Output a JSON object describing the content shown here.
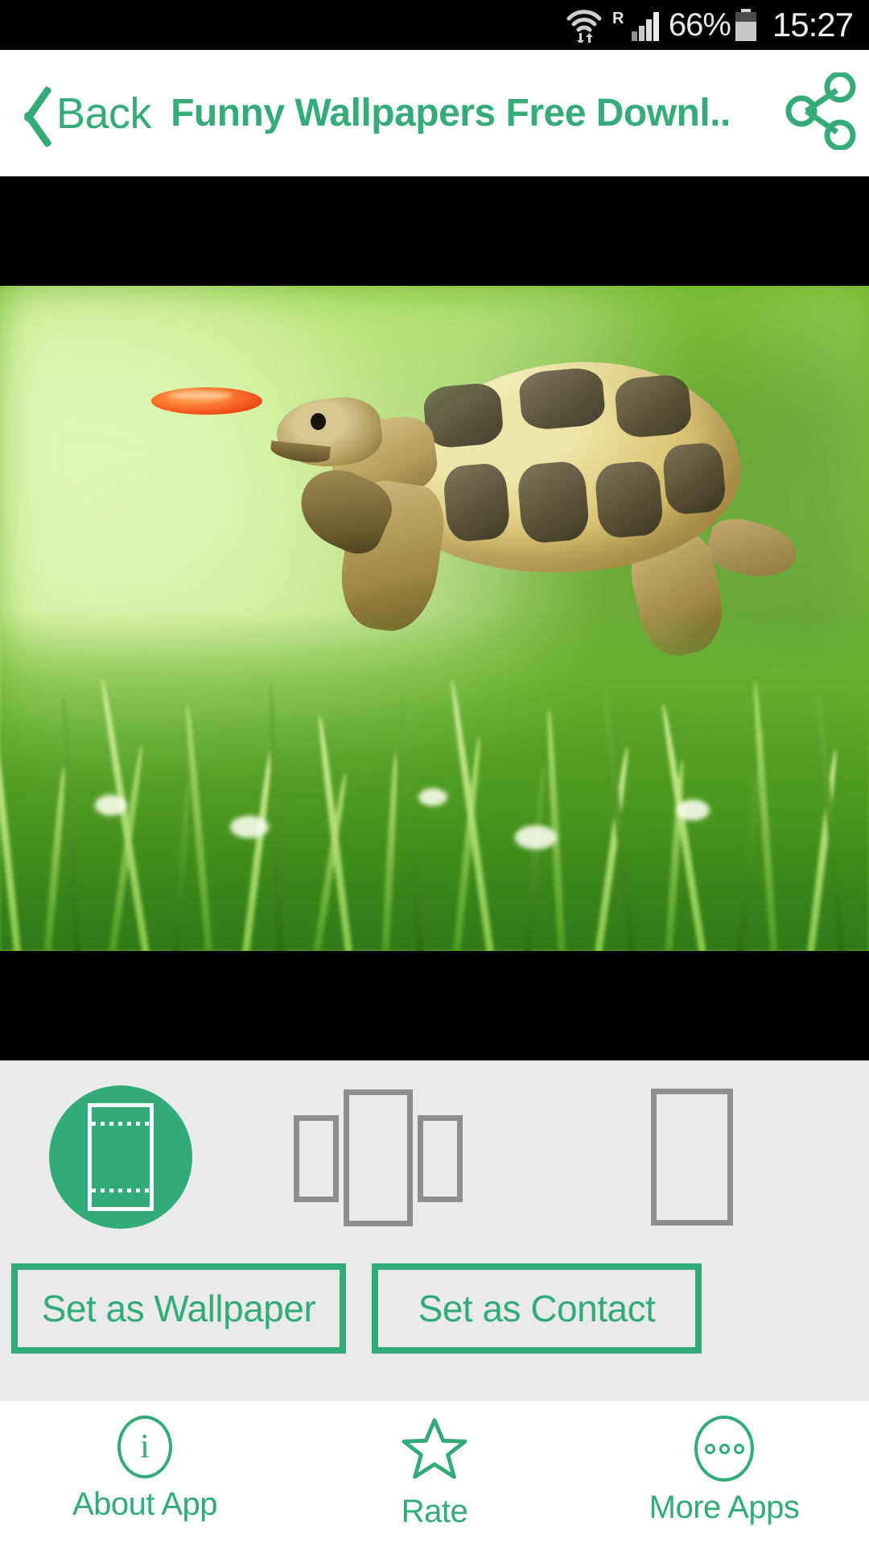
{
  "statusbar": {
    "wifi_icon": "wifi-updown-icon",
    "roaming_label": "R",
    "signal_icon": "signal-bars-icon",
    "battery_percent": "66%",
    "battery_icon": "battery-icon",
    "time": "15:27"
  },
  "header": {
    "back_label": "Back",
    "back_icon": "chevron-left-icon",
    "title": "Funny Wallpapers Free Downl..",
    "share_icon": "share-icon",
    "accent_color": "#31ab77"
  },
  "preview": {
    "letterbox_color": "#000000",
    "wallpaper_description": "Tortoise leaping toward an orange frisbee over green grass"
  },
  "modes": {
    "items": [
      {
        "name": "home-screen",
        "icon": "home-screen-icon",
        "selected": true
      },
      {
        "name": "scrollable-screen",
        "icon": "scrollable-screen-icon",
        "selected": false
      },
      {
        "name": "lock-screen",
        "icon": "lock-screen-icon",
        "selected": false
      }
    ],
    "selected_bg": "#31ab77",
    "inactive_color": "#8d8d8d",
    "panel_bg": "#eaeaea"
  },
  "actions": {
    "set_wallpaper_label": "Set as Wallpaper",
    "set_contact_label": "Set as Contact"
  },
  "bottomnav": {
    "items": [
      {
        "label": "About App",
        "icon": "info-circle-icon"
      },
      {
        "label": "Rate",
        "icon": "star-outline-icon"
      },
      {
        "label": "More Apps",
        "icon": "more-circle-icon"
      }
    ]
  }
}
